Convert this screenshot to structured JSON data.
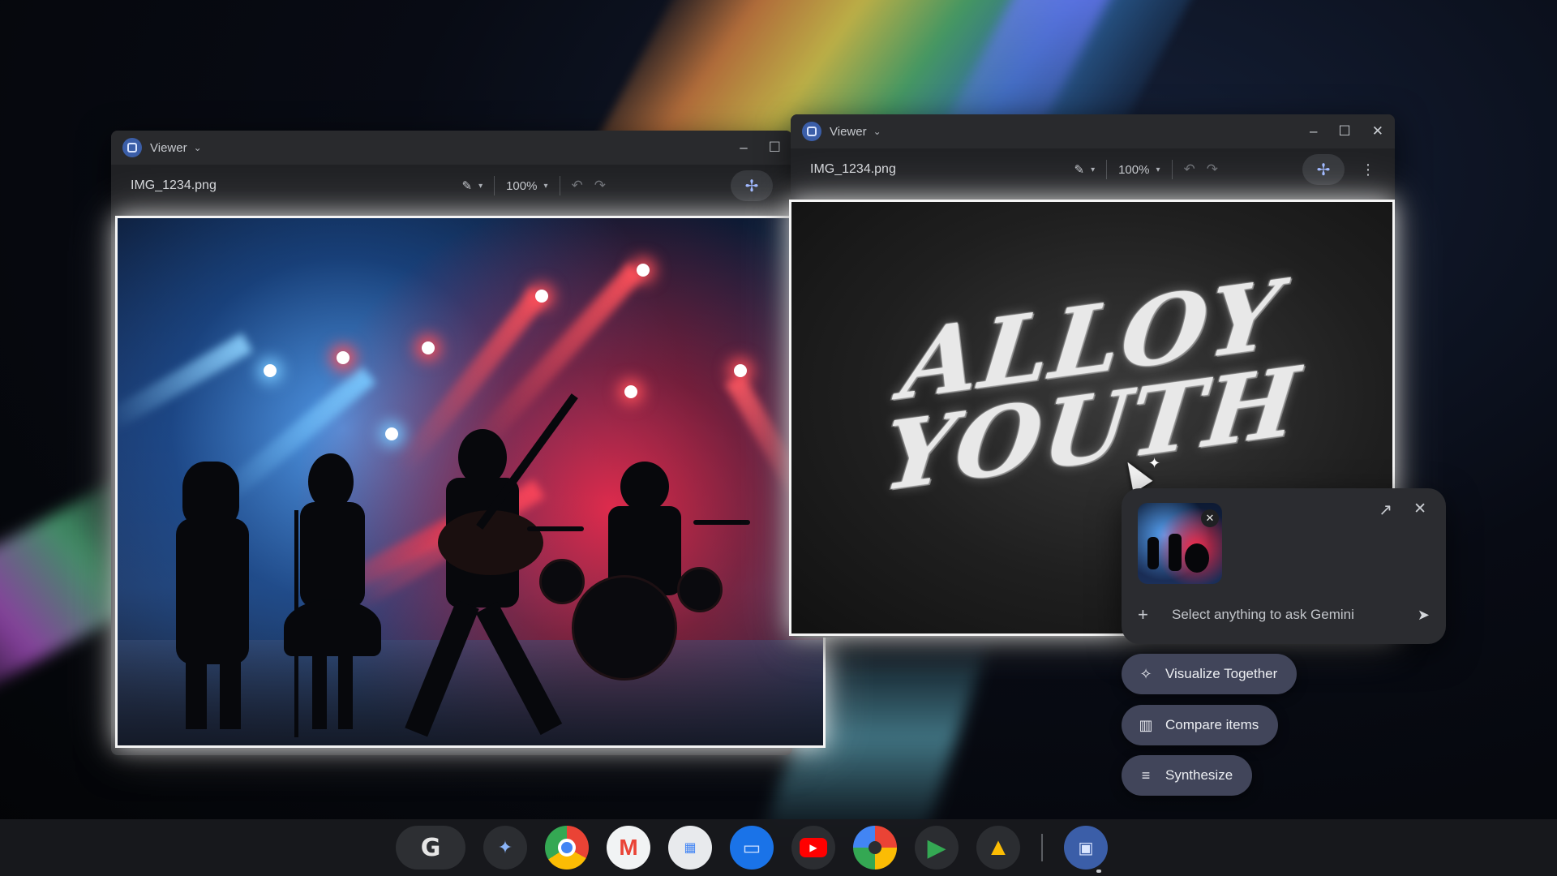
{
  "windows": {
    "left": {
      "app_name": "Viewer",
      "file_name": "IMG_1234.png",
      "zoom": "100%"
    },
    "right": {
      "app_name": "Viewer",
      "file_name": "IMG_1234.png",
      "zoom": "100%"
    }
  },
  "artwork": {
    "line1": "ALLOY",
    "line2": "YOUTH"
  },
  "gemini": {
    "placeholder": "Select anything to ask Gemini"
  },
  "suggestions": [
    {
      "label": "Visualize Together",
      "icon": "sparkle-people-icon"
    },
    {
      "label": "Compare items",
      "icon": "compare-icon"
    },
    {
      "label": "Synthesize",
      "icon": "synthesize-icon"
    }
  ],
  "shelf": {
    "launcher": "G",
    "apps": [
      {
        "name": "gemini-icon",
        "color": "#8ab4f8"
      },
      {
        "name": "chrome-icon",
        "color": "#4285f4"
      },
      {
        "name": "gmail-icon",
        "color": "#ea4335"
      },
      {
        "name": "calendar-icon",
        "color": "#4285f4"
      },
      {
        "name": "files-icon",
        "color": "#1a73e8"
      },
      {
        "name": "youtube-icon",
        "color": "#ff0000"
      },
      {
        "name": "photos-icon",
        "color": "#fbbc04"
      },
      {
        "name": "play-store-icon",
        "color": "#34a853"
      },
      {
        "name": "drive-icon",
        "color": "#0f9d58"
      },
      {
        "name": "viewer-icon",
        "color": "#3b5ea8"
      }
    ]
  }
}
